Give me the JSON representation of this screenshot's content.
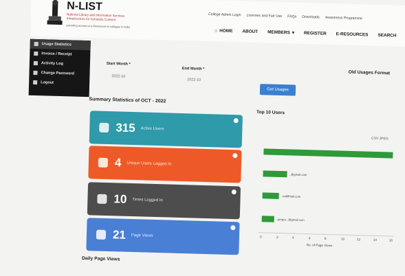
{
  "header": {
    "brand": "N-LIST",
    "tagline": "National Library and Information Services Infrastructure for Scholarly Content",
    "tagline_sub": "providing access to e-Resources to colleges in India"
  },
  "top_links": [
    "College Admin Login",
    "Licenses and Fair Use",
    "FAQs",
    "Downloads",
    "Awareness Programme"
  ],
  "main_nav": {
    "home": "HOME",
    "about": "ABOUT",
    "members": "MEMBERS",
    "register": "REGISTER",
    "eresources": "E-RESOURCES",
    "search": "SEARCH"
  },
  "sidebar": {
    "items": [
      {
        "label": "Usage Statistics"
      },
      {
        "label": "Invoice / Receipt"
      },
      {
        "label": "Activity Log"
      },
      {
        "label": "Change Password"
      },
      {
        "label": "Logout"
      }
    ]
  },
  "filters": {
    "start_label": "Start Month *",
    "start_value": "2022-10",
    "end_label": "End Month *",
    "end_value": "2022-10",
    "get_button": "Get Usages",
    "old_format": "Old Usages Format"
  },
  "summary": {
    "title": "Summary Statistics of OCT - 2022",
    "cards": [
      {
        "value": "315",
        "label": "Active Users",
        "color": "#2f9aa9"
      },
      {
        "value": "4",
        "label": "Unique Users Logged In",
        "color": "#ee5a27"
      },
      {
        "value": "10",
        "label": "Times Logged In",
        "color": "#4d4d4d"
      },
      {
        "value": "21",
        "label": "Page Views",
        "color": "#4a7fd6"
      }
    ]
  },
  "daily_title": "Daily Page Views",
  "top10": {
    "title": "Top 10 Users",
    "export": "CSV   JPEG"
  },
  "chart_data": {
    "type": "bar",
    "orientation": "horizontal",
    "categories": [
      "",
      "...@gmail.com",
      "...rediffmail.com",
      "...jangra...@gmail.com"
    ],
    "values": [
      16,
      3,
      2,
      1.5
    ],
    "xlabel": "No. of Page Views",
    "xlim": [
      0,
      16
    ],
    "xticks": [
      "0",
      "2",
      "4",
      "6",
      "8",
      "10",
      "12",
      "14",
      "16"
    ],
    "bar_color": "#2e9a3a"
  }
}
